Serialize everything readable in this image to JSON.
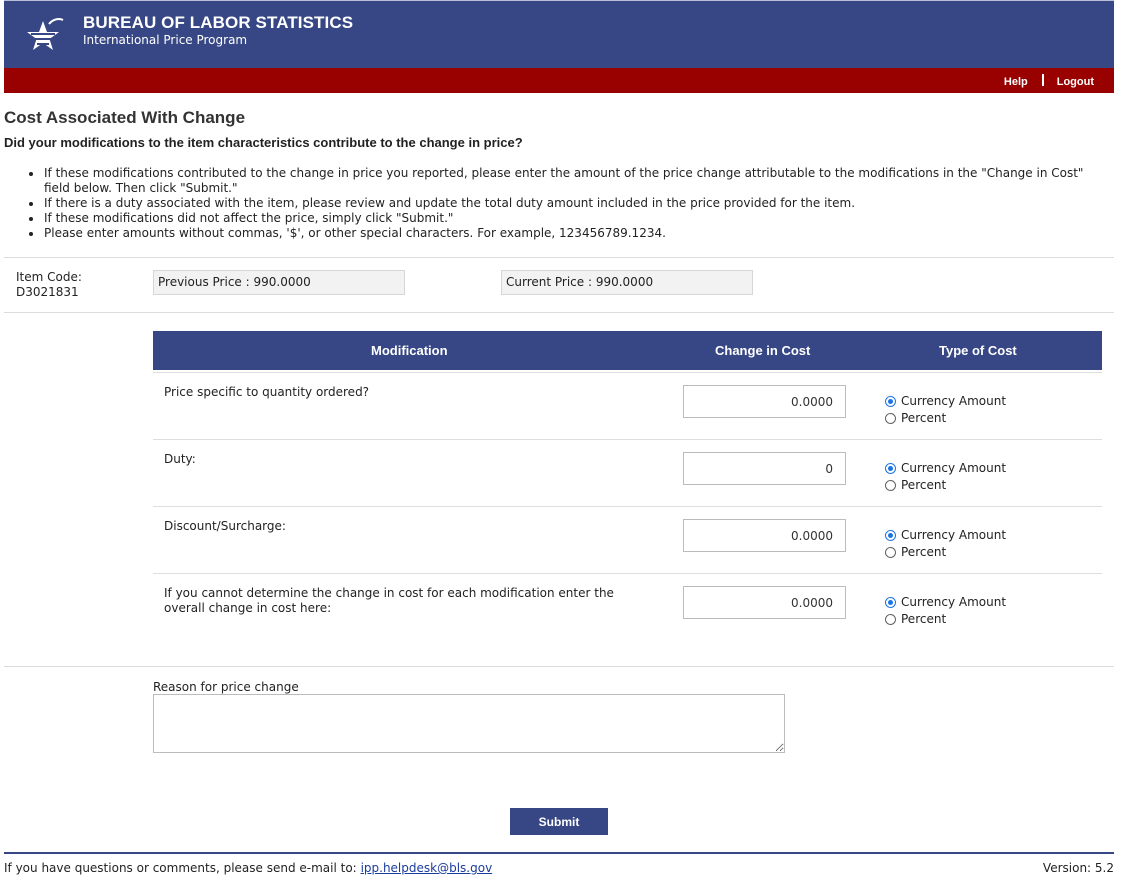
{
  "header": {
    "agency_title": "BUREAU OF LABOR STATISTICS",
    "agency_subtitle": "International Price Program",
    "brand_color": "#374785",
    "accent_color": "#990000"
  },
  "nav": {
    "help": "Help",
    "logout": "Logout"
  },
  "page": {
    "title": "Cost Associated With Change",
    "question": "Did your modifications to the item characteristics contribute to the change in price?",
    "instructions": [
      "If these modifications contributed to the change in price you reported, please enter the amount of the price change attributable to the modifications in the \"Change in Cost\" field below. Then click \"Submit.\"",
      "If there is a duty associated with the item, please review and update the total duty amount included in the price provided for the item.",
      "If these modifications did not affect the price, simply click \"Submit.\"",
      "Please enter amounts without commas, '$', or other special characters. For example, 123456789.1234."
    ]
  },
  "item": {
    "code_label": "Item Code:",
    "code": "D3021831",
    "previous_price": "Previous Price : 990.0000",
    "current_price": "Current Price : 990.0000"
  },
  "table": {
    "headers": {
      "modification": "Modification",
      "change_in_cost": "Change in Cost",
      "type_of_cost": "Type of Cost"
    },
    "rows": [
      {
        "label": "Price specific to quantity ordered?",
        "value": "0.0000",
        "option_currency": "Currency Amount",
        "option_percent": "Percent",
        "selected": "currency"
      },
      {
        "label": "Duty:",
        "value": "0",
        "option_currency": "Currency Amount",
        "option_percent": "Percent",
        "selected": "currency"
      },
      {
        "label": "Discount/Surcharge:",
        "value": "0.0000",
        "option_currency": "Currency Amount",
        "option_percent": "Percent",
        "selected": "currency"
      },
      {
        "label": "If you cannot determine the change in cost for each modification enter the overall change in cost here:",
        "value": "0.0000",
        "option_currency": "Currency Amount",
        "option_percent": "Percent",
        "selected": "currency"
      }
    ]
  },
  "reason": {
    "label": "Reason for price change",
    "value": ""
  },
  "actions": {
    "submit": "Submit"
  },
  "footer": {
    "text": "If you have questions or comments, please send e-mail to:",
    "email": "ipp.helpdesk@bls.gov",
    "version": "Version: 5.2"
  }
}
